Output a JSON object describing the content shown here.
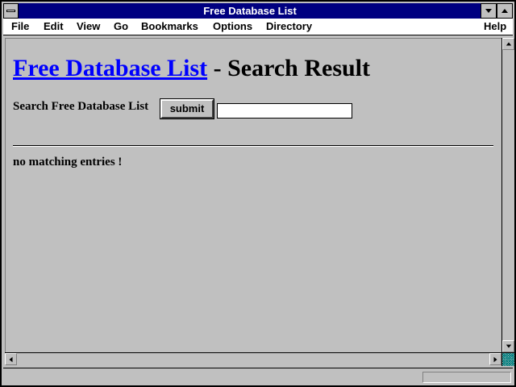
{
  "window": {
    "title": "Free Database List"
  },
  "menubar": {
    "items": [
      {
        "label": "File"
      },
      {
        "label": "Edit"
      },
      {
        "label": "View"
      },
      {
        "label": "Go"
      },
      {
        "label": "Bookmarks"
      },
      {
        "label": "Options"
      },
      {
        "label": "Directory"
      },
      {
        "label": "Help"
      }
    ]
  },
  "page": {
    "heading_link": "Free Database List",
    "heading_rest": " - Search Result",
    "search_label": "Search Free Database List ",
    "submit_label": "submit",
    "search_value": "",
    "result_text": "no matching entries !"
  },
  "colors": {
    "titlebar": "#000080",
    "link": "#0000ff",
    "background": "#c0c0c0"
  },
  "icons": {
    "system_menu": "system-menu-icon",
    "minimize": "minimize-icon",
    "maximize": "maximize-icon",
    "scroll_up": "scroll-up-icon",
    "scroll_down": "scroll-down-icon",
    "scroll_left": "scroll-left-icon",
    "scroll_right": "scroll-right-icon",
    "size_grip": "size-grip-icon"
  }
}
